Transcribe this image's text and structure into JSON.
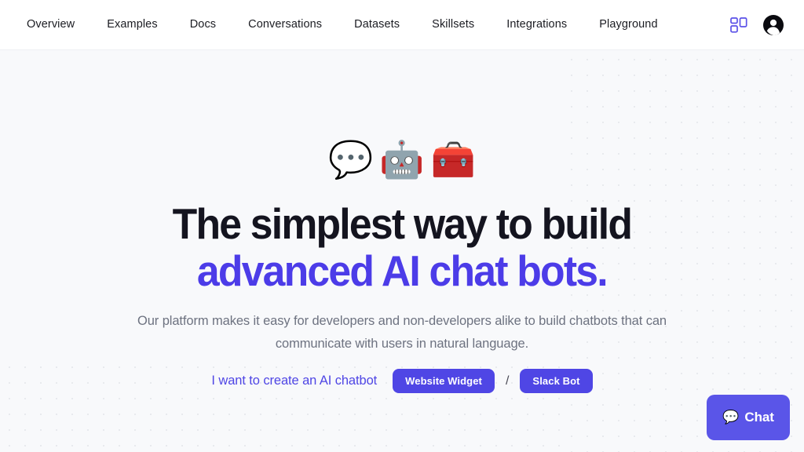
{
  "colors": {
    "accent_purple": "#4f46e5",
    "headline_purple": "#4c3ce8",
    "headline_dark": "#14141f",
    "chat_widget_purple": "#5a55e8",
    "page_background": "#f8f9fb",
    "header_background": "#ffffff",
    "dot_color": "#e4e6eb",
    "subtitle_gray": "#6d7280"
  },
  "header": {
    "nav_items": [
      {
        "label": "Overview"
      },
      {
        "label": "Examples"
      },
      {
        "label": "Docs"
      },
      {
        "label": "Conversations"
      },
      {
        "label": "Datasets"
      },
      {
        "label": "Skillsets"
      },
      {
        "label": "Integrations"
      },
      {
        "label": "Playground"
      }
    ],
    "dashboard_icon": "dashboard-grid-icon",
    "account_icon": "account-avatar-icon"
  },
  "hero": {
    "emojis": [
      {
        "name": "speech-balloon-emoji",
        "glyph": "💬"
      },
      {
        "name": "robot-emoji",
        "glyph": "🤖"
      },
      {
        "name": "toolbox-emoji",
        "glyph": "🧰"
      }
    ],
    "headline_line1": "The simplest way to build",
    "headline_line2": "advanced AI chat bots.",
    "subtitle": "Our platform makes it easy for developers and non-developers alike to build chatbots that can communicate with users in natural language.",
    "cta_text": "I want to create an AI chatbot",
    "primary_button": "Website Widget",
    "separator": "/",
    "secondary_button": "Slack Bot"
  },
  "chat_widget": {
    "icon": "chat-balloon-icon",
    "icon_glyph": "💬",
    "label": "Chat"
  }
}
